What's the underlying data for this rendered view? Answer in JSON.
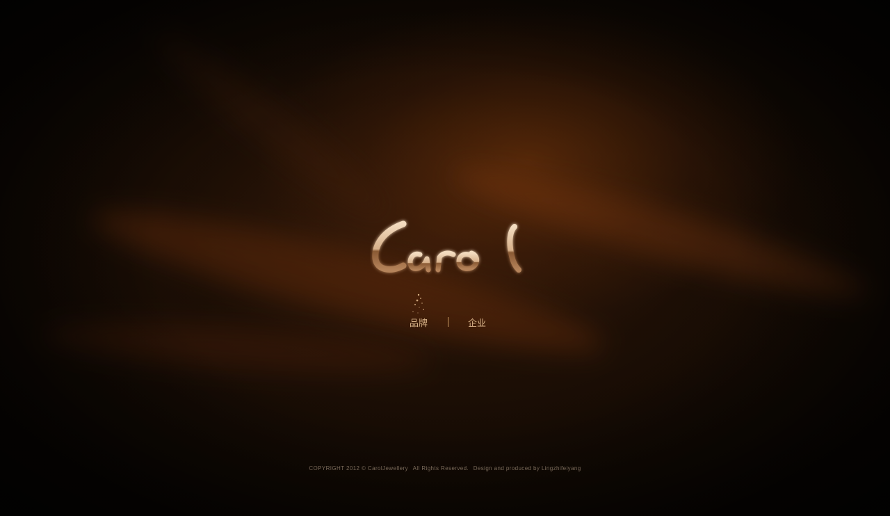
{
  "logo": {
    "text": "Carol",
    "colors": [
      "#f3dcc0",
      "#b5835a",
      "#6b4124"
    ]
  },
  "nav": {
    "items": [
      {
        "label": "品牌"
      },
      {
        "label": "企业"
      }
    ],
    "separator": "|"
  },
  "footer": {
    "copyright": "COPYRIGHT 2012 © CarolJewellery",
    "rights": "All Rights Reserved.",
    "credit": "Design and produced by Lingzhifeiyang"
  },
  "theme": {
    "accent": "#d9b489",
    "background": "#150b04"
  }
}
